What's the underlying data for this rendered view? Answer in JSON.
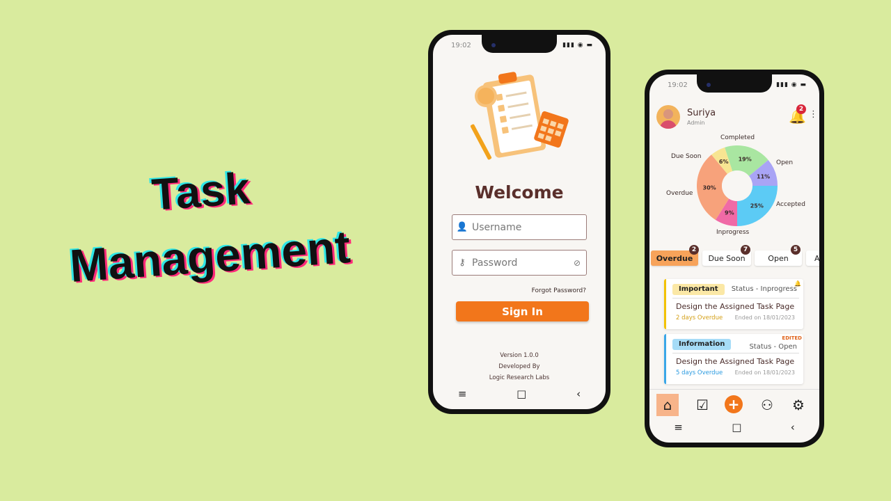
{
  "hero": {
    "line1": "Task",
    "line2": "Management"
  },
  "login_phone": {
    "time": "19:02",
    "status_icons": "▮▮▮ ◉ ▬",
    "welcome": "Welcome",
    "username": {
      "placeholder": "Username",
      "icon": "user-icon"
    },
    "password": {
      "placeholder": "Password",
      "icon": "key-icon",
      "toggle_icon": "eye-off-icon"
    },
    "forgot": "Forgot Password?",
    "signin": "Sign In",
    "version": "Version 1.0.0",
    "developed_by": "Developed By",
    "developer": "Logic Research Labs",
    "nav": [
      "≡",
      "□",
      "‹"
    ]
  },
  "dashboard_phone": {
    "time": "19:02",
    "status_icons": "▮▮▮ ◉ ▬",
    "user": {
      "name": "Suriya",
      "role": "Admin"
    },
    "notification_count": "2",
    "chart_data": {
      "type": "pie",
      "donut": true,
      "slices": [
        {
          "label": "Completed",
          "value": 19,
          "display": "19%",
          "color": "#a9e6a1"
        },
        {
          "label": "Open",
          "value": 11,
          "display": "11%",
          "color": "#a9a4f5"
        },
        {
          "label": "Accepted",
          "value": 25,
          "display": "25%",
          "color": "#5ccbf5"
        },
        {
          "label": "Inprogress",
          "value": 9,
          "display": "9%",
          "color": "#f06aa6"
        },
        {
          "label": "Overdue",
          "value": 30,
          "display": "30%",
          "color": "#f7a27b"
        },
        {
          "label": "Due Soon",
          "value": 6,
          "display": "6%",
          "color": "#f7e592"
        }
      ]
    },
    "tabs": [
      {
        "label": "Overdue",
        "count": "2"
      },
      {
        "label": "Due Soon",
        "count": "7"
      },
      {
        "label": "Open",
        "count": "5"
      },
      {
        "label": "Ac",
        "count": ""
      }
    ],
    "cards": [
      {
        "tag": "Important",
        "tag_color": "#fbe8a6",
        "accent": "#f2c200",
        "status": "Status - Inprogress",
        "title": "Design the Assigned Task Page",
        "due": "2 days Overdue",
        "due_color": "#d4a017",
        "ended": "Ended on 18/01/2023",
        "flag": ""
      },
      {
        "tag": "Information",
        "tag_color": "#a6dcf7",
        "accent": "#3aa7e8",
        "status": "Status - Open",
        "title": "Design the Assigned Task Page",
        "due": "5 days Overdue",
        "due_color": "#2a9ae0",
        "ended": "Ended on 18/01/2023",
        "flag": "EDITED"
      }
    ],
    "bottom_nav": [
      "home-icon",
      "task-check-icon",
      "add-icon",
      "team-icon",
      "settings-icon"
    ],
    "nav": [
      "≡",
      "□",
      "‹"
    ]
  }
}
